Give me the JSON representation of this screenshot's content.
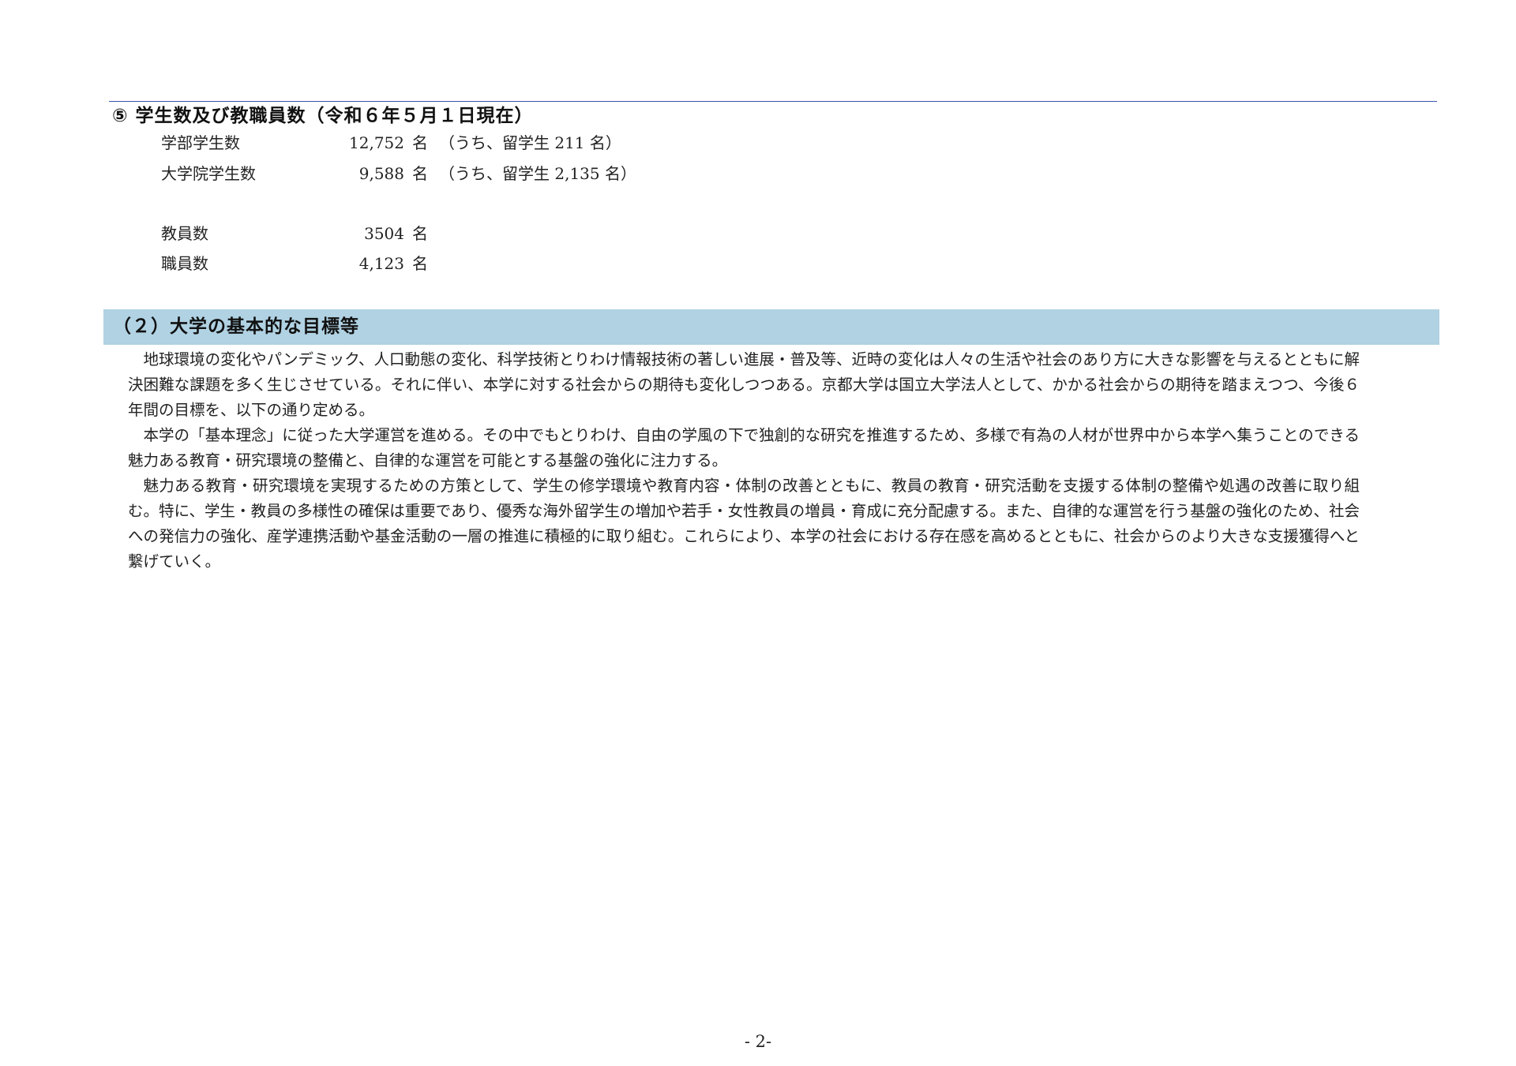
{
  "section_heading": "⑤ 学生数及び教職員数（令和６年５月１日現在）",
  "students": [
    {
      "label": "学部学生数",
      "count": "12,752",
      "unit": "名",
      "note": "（うち、留学生 211 名）"
    },
    {
      "label": "大学院学生数",
      "count": "9,588",
      "unit": "名",
      "note": "（うち、留学生 2,135 名）"
    }
  ],
  "staff": [
    {
      "label": "教員数",
      "count": "3504",
      "unit": "名"
    },
    {
      "label": "職員数",
      "count": "4,123",
      "unit": "名"
    }
  ],
  "goals_section": {
    "title": "（２）大学の基本的な目標等",
    "paragraphs": [
      "地球環境の変化やパンデミック、人口動態の変化、科学技術とりわけ情報技術の著しい進展・普及等、近時の変化は人々の生活や社会のあり方に大きな影響を与えるとともに解決困難な課題を多く生じさせている。それに伴い、本学に対する社会からの期待も変化しつつある。京都大学は国立大学法人として、かかる社会からの期待を踏まえつつ、今後６年間の目標を、以下の通り定める。",
      "本学の「基本理念」に従った大学運営を進める。その中でもとりわけ、自由の学風の下で独創的な研究を推進するため、多様で有為の人材が世界中から本学へ集うことのできる魅力ある教育・研究環境の整備と、自律的な運営を可能とする基盤の強化に注力する。",
      "魅力ある教育・研究環境を実現するための方策として、学生の修学環境や教育内容・体制の改善とともに、教員の教育・研究活動を支援する体制の整備や処遇の改善に取り組む。特に、学生・教員の多様性の確保は重要であり、優秀な海外留学生の増加や若手・女性教員の増員・育成に充分配慮する。また、自律的な運営を行う基盤の強化のため、社会への発信力の強化、産学連携活動や基金活動の一層の推進に積極的に取り組む。これらにより、本学の社会における存在感を高めるとともに、社会からのより大きな支援獲得へと繋げていく。"
    ]
  },
  "page_number": "- 2-"
}
